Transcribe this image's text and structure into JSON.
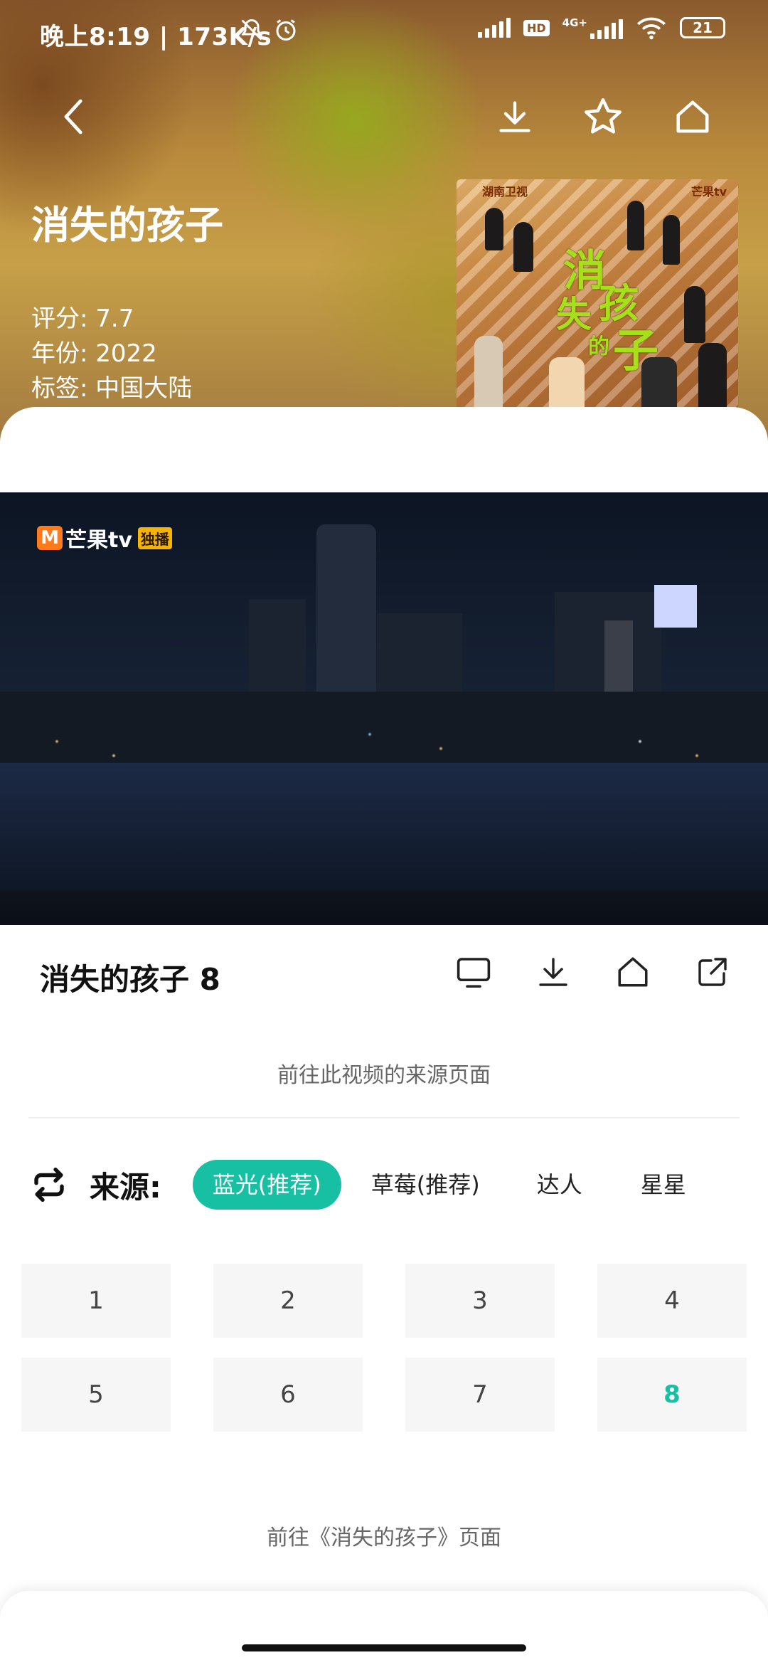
{
  "status_bar": {
    "time_speed": "晚上8:19 | 173K/s",
    "hd": "HD",
    "network": "4G+",
    "battery": "21"
  },
  "show": {
    "title": "消失的孩子",
    "rating": "评分: 7.7",
    "year": "年份: 2022",
    "tags": "标签: 中国大陆"
  },
  "poster": {
    "title_chars": [
      "消",
      "失",
      "孩",
      "的",
      "子"
    ],
    "brand_left": "湖南卫视",
    "brand_right": "芒果tv"
  },
  "video": {
    "brand_m": "M",
    "brand_text": "芒果tv",
    "brand_badge": "独播"
  },
  "episode": {
    "title": "消失的孩子 8"
  },
  "links": {
    "source_page": "前往此视频的来源页面",
    "show_page": "前往《消失的孩子》页面"
  },
  "sources": {
    "label": "来源:",
    "items": [
      "蓝光(推荐)",
      "草莓(推荐)",
      "达人",
      "星星"
    ],
    "selected": "蓝光(推荐)"
  },
  "episodes": {
    "items": [
      "1",
      "2",
      "3",
      "4",
      "5",
      "6",
      "7",
      "8"
    ],
    "selected": "8"
  },
  "colors": {
    "accent": "#17bfa3",
    "header_bg": "#b98a3c"
  },
  "icons": [
    "back-icon",
    "download-icon",
    "star-icon",
    "home-icon",
    "tv-icon",
    "share-icon",
    "switch-icon"
  ]
}
